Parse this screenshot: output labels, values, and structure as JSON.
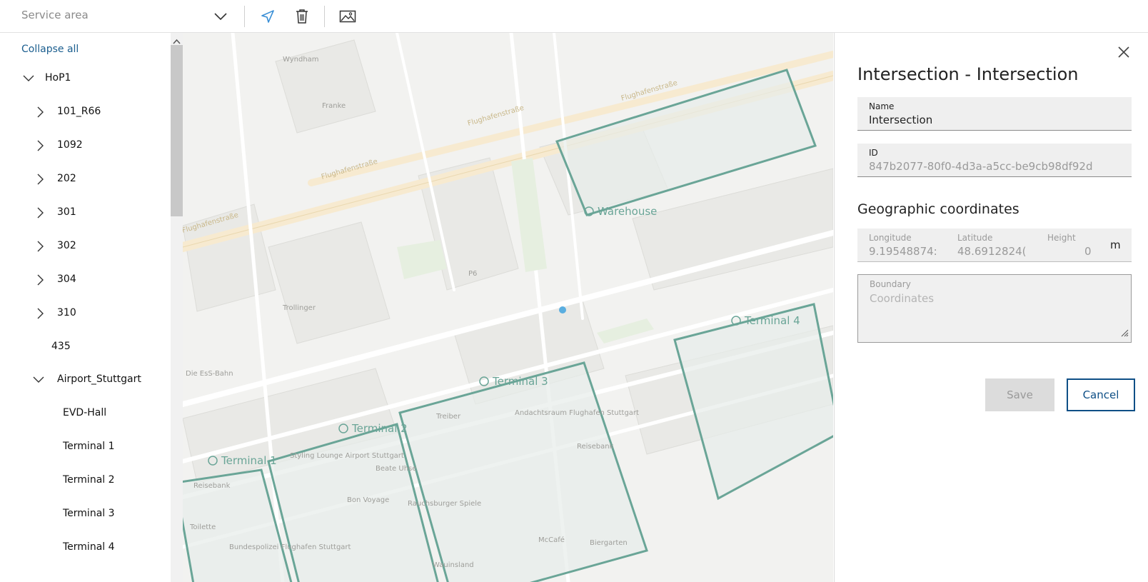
{
  "toolbar": {
    "service_area_placeholder": "Service area",
    "icons": [
      "chevron-down-icon",
      "navigate-arrow-icon",
      "trash-icon",
      "image-icon"
    ]
  },
  "sidebar": {
    "collapse_all": "Collapse all",
    "tree": [
      {
        "label": "HoP1",
        "state": "expanded"
      },
      {
        "label": "101_R66",
        "state": "collapsed"
      },
      {
        "label": "1092",
        "state": "collapsed"
      },
      {
        "label": "202",
        "state": "collapsed"
      },
      {
        "label": "301",
        "state": "collapsed"
      },
      {
        "label": "302",
        "state": "collapsed"
      },
      {
        "label": "304",
        "state": "collapsed"
      },
      {
        "label": "310",
        "state": "collapsed"
      },
      {
        "label": "435",
        "state": "leaf"
      },
      {
        "label": "Airport_Stuttgart",
        "state": "expanded"
      },
      {
        "label": "EVD-Hall",
        "state": "leaf"
      },
      {
        "label": "Terminal 1",
        "state": "leaf"
      },
      {
        "label": "Terminal 2",
        "state": "leaf"
      },
      {
        "label": "Terminal 3",
        "state": "leaf"
      },
      {
        "label": "Terminal 4",
        "state": "leaf"
      }
    ]
  },
  "map": {
    "area_labels": [
      "Warehouse",
      "Terminal 4",
      "Terminal 3",
      "Terminal 2",
      "Terminal 1"
    ],
    "street_labels": [
      "Flughafenstraße",
      "Flughafenstraße",
      "Flughafenstraße",
      "Flughafenstraße"
    ],
    "poi_labels": [
      "Wyndham",
      "Franke",
      "P6",
      "Trollinger",
      "Die EsS-Bahn",
      "Andachtsraum Flughafen Stuttgart",
      "Treiber",
      "Styling Lounge Airport Stuttgart",
      "Beate Uhse",
      "Reisebank",
      "Bon Voyage",
      "Rauchsburger Spiele",
      "McCafé",
      "Biergarten",
      "Bundespolizei Flughafen Stuttgart",
      "Toilette",
      "Reisebank",
      "Wauinsland"
    ],
    "area_color": "#6aa597",
    "marker_color": "#5aaee0"
  },
  "panel": {
    "title": "Intersection - Intersection",
    "name_label": "Name",
    "name_value": "Intersection",
    "id_label": "ID",
    "id_value": "847b2077-80f0-4d3a-a5cc-be9cb98df92d",
    "geo_heading": "Geographic coordinates",
    "longitude_label": "Longitude",
    "longitude_value": "9.19548874:",
    "latitude_label": "Latitude",
    "latitude_value": "48.6912824(",
    "height_label": "Height",
    "height_value": "0",
    "height_unit": "m",
    "boundary_label": "Boundary",
    "boundary_placeholder": "Coordinates",
    "save_label": "Save",
    "cancel_label": "Cancel",
    "accent": "#0e4f86"
  }
}
